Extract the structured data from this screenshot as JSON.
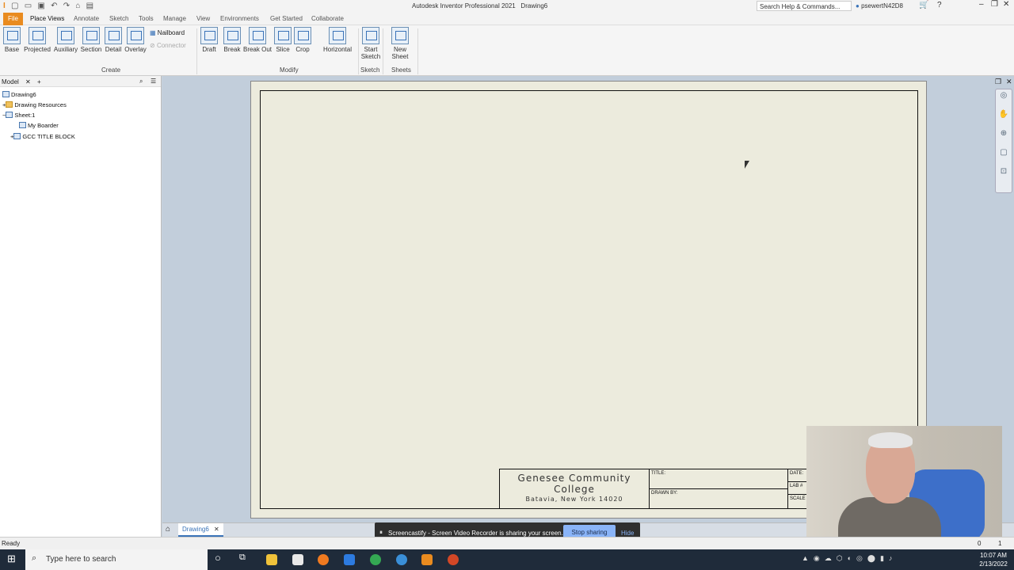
{
  "title_bar": {
    "app_title": "Autodesk Inventor Professional 2021",
    "doc_title": "Drawing6",
    "search_placeholder": "Search Help & Commands...",
    "user": "psewertN42D8"
  },
  "menu_tabs": [
    "File",
    "Place Views",
    "Annotate",
    "Sketch",
    "Tools",
    "Manage",
    "View",
    "Environments",
    "Get Started",
    "Collaborate"
  ],
  "ribbon": {
    "create": {
      "label": "Create",
      "buttons": [
        "Base",
        "Projected",
        "Auxiliary",
        "Section",
        "Detail",
        "Overlay"
      ],
      "small": [
        "Nailboard",
        "Connector"
      ]
    },
    "modify": {
      "label": "Modify",
      "buttons": [
        "Draft",
        "Break",
        "Break Out",
        "Slice",
        "Crop",
        "Horizontal"
      ]
    },
    "sketch": {
      "label": "Sketch",
      "button": "Start\nSketch"
    },
    "sheets": {
      "label": "Sheets",
      "button": "New Sheet"
    }
  },
  "browser": {
    "tab": "Model",
    "nodes": [
      "Drawing6",
      "Drawing Resources",
      "Sheet:1",
      "My Boarder",
      "GCC TITLE BLOCK"
    ]
  },
  "title_block": {
    "college_line1": "Genesee Community",
    "college_line2": "College",
    "address": "Batavia, New York 14020",
    "title_label": "TITLE:",
    "drawn_by_label": "DRAWN BY:",
    "date_label": "DATE:",
    "lab_label": "LAB #",
    "scale_label": "SCALE"
  },
  "doc_tab": "Drawing6",
  "status": {
    "text": "Ready",
    "count1": "0",
    "count2": "1"
  },
  "screencastify": {
    "message": "Screencastify - Screen Video Recorder is sharing your screen.",
    "stop": "Stop sharing",
    "hide": "Hide"
  },
  "taskbar": {
    "search_placeholder": "Type here to search",
    "time": "10:07 AM",
    "date": "2/13/2022"
  },
  "colors": {
    "file_tab": "#e98b1f",
    "sheet": "#ecebdd",
    "canvas": "#c2cedb",
    "taskbar": "#1f2b3a",
    "stop_button": "#8ab4f8"
  }
}
